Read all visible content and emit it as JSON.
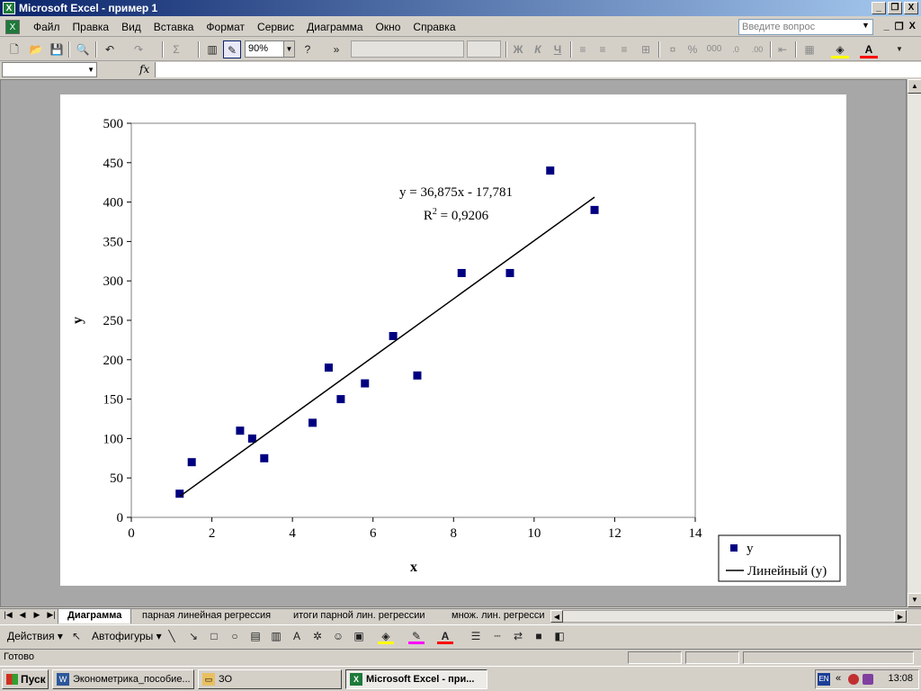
{
  "window": {
    "title": "Microsoft Excel - пример 1",
    "app_icon": "excel-icon",
    "buttons": [
      "_",
      "❐",
      "X"
    ]
  },
  "menu": {
    "items": [
      "Файл",
      "Правка",
      "Вид",
      "Вставка",
      "Формат",
      "Сервис",
      "Диаграмма",
      "Окно",
      "Справка"
    ],
    "help_placeholder": "Введите вопрос",
    "doc_buttons": [
      "_",
      "❐",
      "X"
    ]
  },
  "toolbar": {
    "zoom": "90%",
    "sum_symbol": "Σ",
    "bold": "Ж",
    "italic": "К",
    "underline": "Ч",
    "percent": "%",
    "thousands": "000",
    "more": "»"
  },
  "formula_bar": {
    "fx_label": "fx",
    "name_box": "",
    "formula": ""
  },
  "chart_data": {
    "type": "scatter",
    "title": "",
    "xlabel": "x",
    "ylabel": "y",
    "xlim": [
      0,
      14
    ],
    "ylim": [
      0,
      500
    ],
    "x_ticks": [
      0,
      2,
      4,
      6,
      8,
      10,
      12,
      14
    ],
    "y_ticks": [
      0,
      50,
      100,
      150,
      200,
      250,
      300,
      350,
      400,
      450,
      500
    ],
    "grid": false,
    "series": [
      {
        "name": "y",
        "marker": "square",
        "color": "#000080",
        "x": [
          1.2,
          1.5,
          2.7,
          3.0,
          3.3,
          4.5,
          4.9,
          5.2,
          5.8,
          6.5,
          7.1,
          8.2,
          9.4,
          10.4,
          11.5
        ],
        "y": [
          30,
          70,
          110,
          100,
          75,
          120,
          190,
          150,
          170,
          230,
          180,
          310,
          310,
          440,
          390
        ]
      }
    ],
    "trendline": {
      "name": "Линейный (y)",
      "slope": 36.875,
      "intercept": -17.781,
      "x_range": [
        1.2,
        11.5
      ],
      "equation": "y = 36,875x - 17,781",
      "r2_prefix": "R",
      "r2_sup": "2",
      "r2_value": " = 0,9206"
    },
    "legend_position": "bottom-right"
  },
  "sheet_tabs": {
    "tabs": [
      "Диаграмма",
      "парная линейная регрессия",
      "итоги парной лин. регрессии",
      "множ. лин. регресси"
    ],
    "active": 0
  },
  "drawing_toolbar": {
    "actions": "Действия",
    "autoshapes": "Автофигуры"
  },
  "status": {
    "text": "Готово"
  },
  "taskbar": {
    "start": "Пуск",
    "buttons": [
      "Эконометрика_пособие...",
      "ЗО",
      "Microsoft Excel - при..."
    ],
    "active": 2,
    "lang": "EN",
    "clock": "13:08"
  }
}
